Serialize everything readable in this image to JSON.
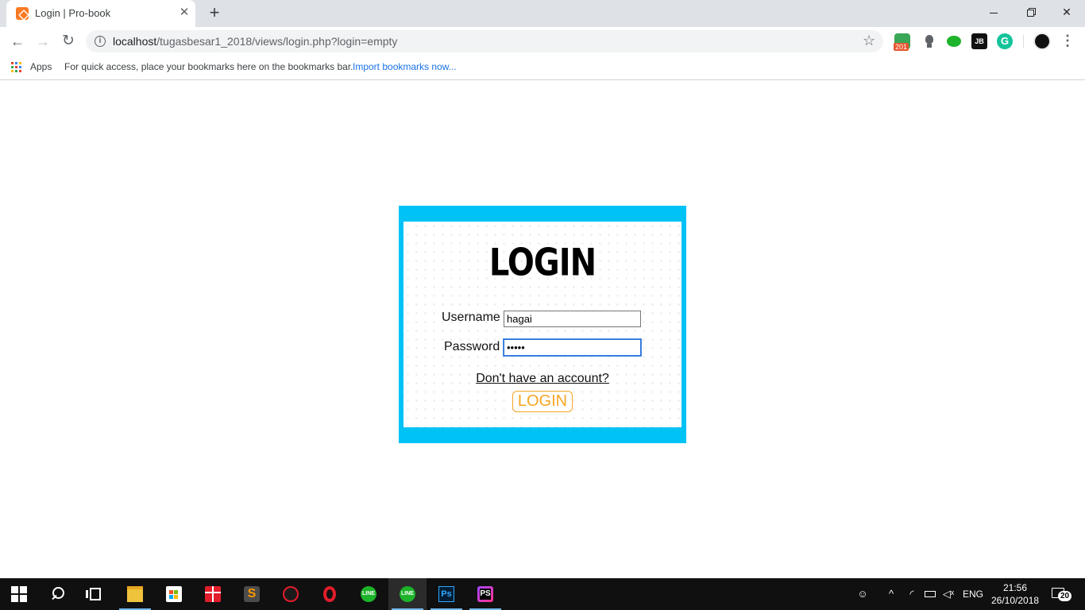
{
  "browser": {
    "tab": {
      "title": "Login | Pro-book"
    },
    "url": {
      "host": "localhost",
      "path": "/tugasbesar1_2018/views/login.php?login=empty"
    },
    "extensions": [
      {
        "name": "adblock-extension",
        "badge": "201"
      },
      {
        "name": "lightbulb-extension"
      },
      {
        "name": "line-share-extension"
      },
      {
        "name": "jetbrains-extension",
        "label": "JB"
      },
      {
        "name": "grammarly-extension",
        "label": "G"
      }
    ],
    "bookmarks": {
      "apps_label": "Apps",
      "hint": "For quick access, place your bookmarks here on the bookmarks bar.",
      "import_link": "Import bookmarks now..."
    }
  },
  "login": {
    "title": "LOGIN",
    "username_label": "Username",
    "username_value": "hagai",
    "password_label": "Password",
    "password_value": "•••••",
    "signup_link": "Don't have an account?",
    "submit_label": "LOGIN"
  },
  "colors": {
    "frame": "#00c2f5",
    "button": "#f5a623",
    "link": "#1a73e8"
  },
  "taskbar": {
    "apps": [
      "start",
      "search",
      "task-view",
      "file-explorer",
      "microsoft-store",
      "gift",
      "sublime-text",
      "garena",
      "opera",
      "line",
      "line",
      "photoshop",
      "phpstorm"
    ],
    "sublime_label": "S",
    "line_label": "LINE",
    "photoshop_label": "Ps",
    "phpstorm_label": "PS",
    "tray": {
      "language": "ENG",
      "time": "21:56",
      "date": "26/10/2018",
      "notifications": "20"
    }
  }
}
